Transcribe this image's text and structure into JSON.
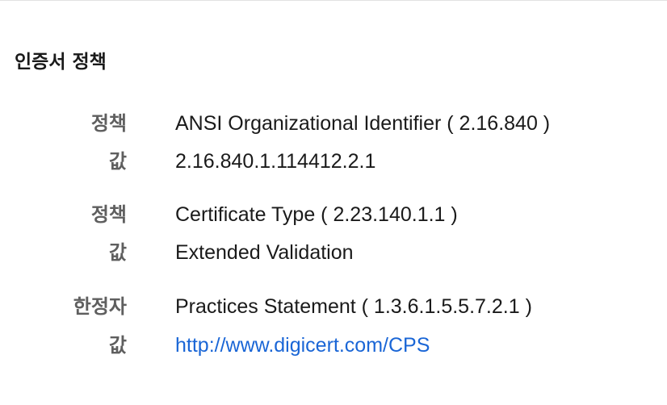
{
  "section": {
    "title": "인증서 정책"
  },
  "entries": [
    {
      "label": "정책",
      "value": "ANSI Organizational Identifier ( 2.16.840 )"
    },
    {
      "label": "값",
      "value": "2.16.840.1.114412.2.1"
    },
    {
      "label": "정책",
      "value": "Certificate Type ( 2.23.140.1.1 )"
    },
    {
      "label": "값",
      "value": "Extended Validation"
    },
    {
      "label": "한정자",
      "value": "Practices Statement ( 1.3.6.1.5.5.7.2.1 )"
    },
    {
      "label": "값",
      "value": "http://www.digicert.com/CPS",
      "link_color": "#1a66d6"
    }
  ]
}
